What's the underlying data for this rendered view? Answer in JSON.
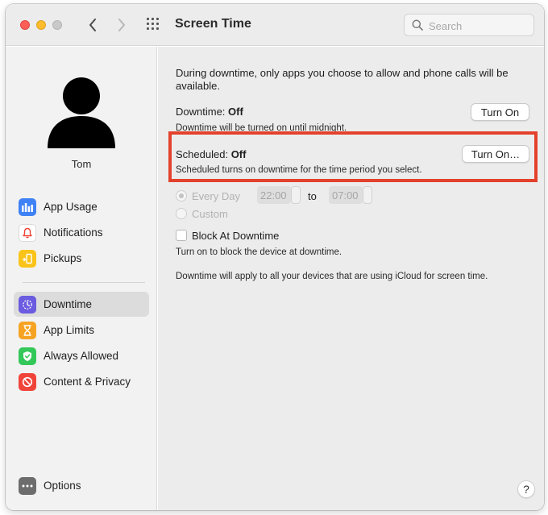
{
  "window": {
    "title": "Screen Time"
  },
  "search": {
    "placeholder": "Search"
  },
  "sidebar": {
    "user_name": "Tom",
    "items": [
      {
        "label": "App Usage",
        "icon": "bar-chart-icon",
        "color": "#3f82f5"
      },
      {
        "label": "Notifications",
        "icon": "bell-icon",
        "color": "#ffffff"
      },
      {
        "label": "Pickups",
        "icon": "phone-pickup-icon",
        "color": "#f9c31a"
      },
      {
        "label": "Downtime",
        "icon": "downtime-icon",
        "color": "#6a5be0",
        "active": true
      },
      {
        "label": "App Limits",
        "icon": "hourglass-icon",
        "color": "#f6a323"
      },
      {
        "label": "Always Allowed",
        "icon": "checkmark-shield-icon",
        "color": "#34c759"
      },
      {
        "label": "Content & Privacy",
        "icon": "prohibited-icon",
        "color": "#f0443a"
      }
    ],
    "options_label": "Options"
  },
  "main": {
    "intro": "During downtime, only apps you choose to allow and phone calls will be available.",
    "downtime": {
      "label": "Downtime:",
      "status": "Off",
      "button": "Turn On",
      "caption": "Downtime will be turned on until midnight."
    },
    "scheduled": {
      "label": "Scheduled:",
      "status": "Off",
      "button": "Turn On…",
      "caption": "Scheduled turns on downtime for the time period you select."
    },
    "schedule_options": {
      "every_day": "Every Day",
      "custom": "Custom",
      "from_time": "22:00",
      "to_word": "to",
      "to_time": "07:00"
    },
    "block": {
      "label": "Block At Downtime",
      "caption": "Turn on to block the device at downtime."
    },
    "footer_note": "Downtime will apply to all your devices that are using iCloud for screen time.",
    "help": "?"
  },
  "colors": {
    "highlight": "#e4412d"
  }
}
